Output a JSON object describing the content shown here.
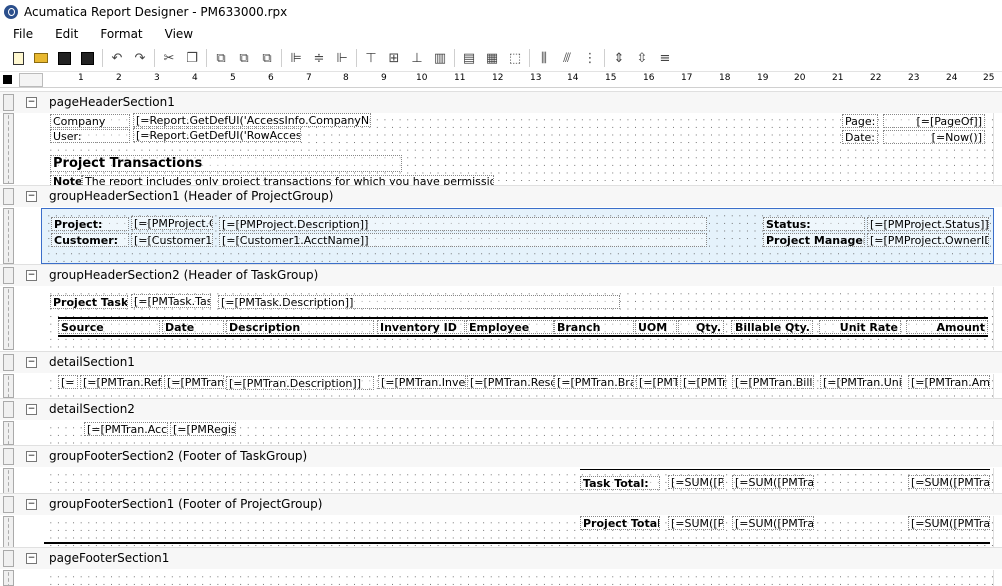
{
  "window": {
    "title": "Acumatica Report Designer - PM633000.rpx"
  },
  "menu": [
    "File",
    "Edit",
    "Format",
    "View"
  ],
  "toolbar": {
    "icons": [
      "new-report-icon",
      "open-icon",
      "save-icon",
      "save-as-icon",
      "undo-icon",
      "redo-icon",
      "cut-icon",
      "copy-icon",
      "bring-front-icon",
      "send-back-icon",
      "group-icon",
      "align-left-icon",
      "align-center-icon",
      "align-right-icon",
      "align-top-icon",
      "align-middle-icon",
      "align-bottom-icon",
      "same-size-icon",
      "size-grid-icon",
      "size-icon",
      "hspace-equal-icon",
      "hspace-inc-icon",
      "hspace-dec-icon",
      "vspace-equal-icon",
      "vspace-inc-icon",
      "vspace-dec-icon"
    ]
  },
  "ruler": {
    "numbers": [
      "1",
      "2",
      "3",
      "4",
      "5",
      "6",
      "7",
      "8",
      "9",
      "10",
      "11",
      "12",
      "13",
      "14",
      "15",
      "16",
      "17",
      "18",
      "19",
      "20",
      "21",
      "22",
      "23",
      "24",
      "25"
    ]
  },
  "sections": {
    "pageHeader": {
      "label": "pageHeaderSection1",
      "company_label": "Company",
      "company_value": "[=Report.GetDefUI('AccessInfo.CompanyName",
      "user_label": "User:",
      "user_value": "[=Report.GetDefUI('RowAccessIn",
      "page_label": "Page:",
      "page_value": "[=[PageOf]]",
      "date_label": "Date:",
      "date_value": "[=Now()]",
      "title": "Project Transactions",
      "note_label": "Note:",
      "note_text": "The report includes only project transactions for which you have permissions to view."
    },
    "groupHeader1": {
      "label": "groupHeaderSection1 (Header of ProjectGroup)",
      "project_label": "Project:",
      "project_value": "[=[PMProject.C",
      "project_desc": "[=[PMProject.Description]]",
      "customer_label": "Customer:",
      "customer_value": "[=[Customer1.",
      "customer_name": "[=[Customer1.AcctName]]",
      "status_label": "Status:",
      "status_value": "[=[PMProject.Status]]",
      "pm_label": "Project Manager:",
      "pm_value": "[=[PMProject.OwnerID_"
    },
    "groupHeader2": {
      "label": "groupHeaderSection2 (Header of TaskGroup)",
      "task_label": "Project Task:",
      "task_value": "[=[PMTask.Tas",
      "task_desc": "[=[PMTask.Description]]",
      "columns": [
        "Source",
        "Date",
        "Description",
        "Inventory ID",
        "Employee",
        "Branch",
        "UOM",
        "Qty.",
        "Billable Qty.",
        "Unit Rate",
        "Amount"
      ]
    },
    "detail1": {
      "label": "detailSection1",
      "cells": [
        "[=",
        "[=[PMTran.RefN",
        "[=[PMTran.",
        "[=[PMTran.Description]]",
        "[=[PMTran.Invent",
        "[=[PMTran.Reso",
        "[=[PMTran.Bra",
        "[=[PMT",
        "[=[PMTr",
        "[=[PMTran.Billa",
        "[=[PMTran.Unit",
        "[=[PMTran.Am"
      ]
    },
    "detail2": {
      "label": "detailSection2",
      "cells": [
        "[=[PMTran.Acco",
        "[=[PMRegist"
      ]
    },
    "groupFooter2": {
      "label": "groupFooterSection2 (Footer of TaskGroup)",
      "total_label": "Task Total:",
      "cells": [
        "[=SUM([P",
        "[=SUM([PMTra",
        "[=SUM([PMTra"
      ]
    },
    "groupFooter1": {
      "label": "groupFooterSection1 (Footer of ProjectGroup)",
      "total_label": "Project Total:",
      "cells": [
        "[=SUM([P",
        "[=SUM([PMTra",
        "[=SUM([PMTra"
      ]
    },
    "pageFooter": {
      "label": "pageFooterSection1"
    }
  },
  "colors": {
    "selected_band": "#e5f2fb",
    "selected_border": "#3b6ec9"
  }
}
